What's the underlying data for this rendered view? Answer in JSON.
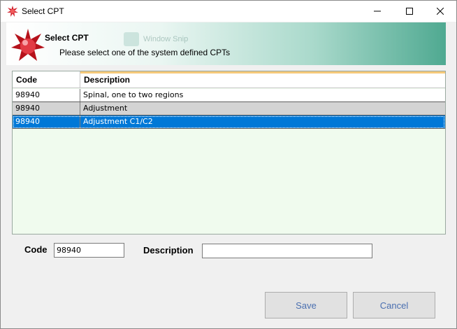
{
  "window": {
    "title": "Select CPT"
  },
  "header": {
    "title": "Select CPT",
    "subtitle": "Please select one of the system defined CPTs",
    "ghost_overlay": "Window Snip"
  },
  "grid": {
    "columns": [
      "Code",
      "Description"
    ],
    "rows": [
      {
        "code": "98940",
        "description": "Spinal, one to two regions"
      },
      {
        "code": "98940",
        "description": "Adjustment"
      },
      {
        "code": "98940",
        "description": "Adjustment C1/C2"
      }
    ],
    "selected_index": 2
  },
  "form": {
    "code_label": "Code",
    "code_value": "98940",
    "description_label": "Description",
    "description_value": ""
  },
  "buttons": {
    "save": "Save",
    "cancel": "Cancel"
  },
  "colors": {
    "selection": "#0078d7",
    "header_gradient_end": "#4fa991",
    "grid_background": "#f0fbee",
    "button_text": "#4a6fb0"
  },
  "icons": [
    "app-star-icon",
    "minimize-icon",
    "maximize-icon",
    "close-icon",
    "header-star-logo-icon"
  ]
}
